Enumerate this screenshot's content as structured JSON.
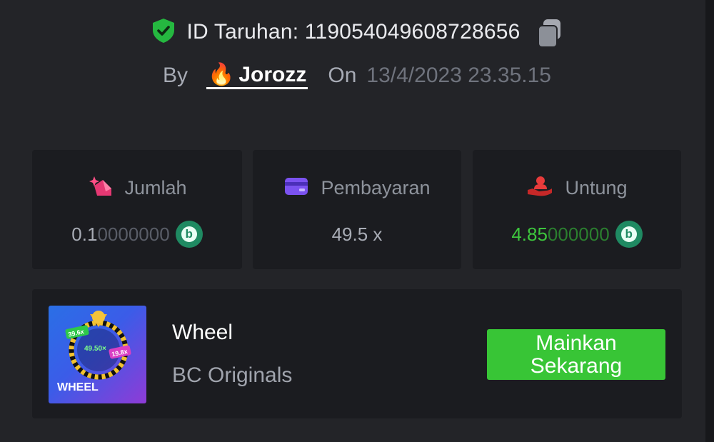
{
  "header": {
    "bet_id_label": "ID Taruhan:",
    "bet_id": "119054049608728656",
    "by_label": "By",
    "username": "Jorozz",
    "user_icon": "🔥",
    "on_label": "On",
    "date": "13/4/2023 23.35.15"
  },
  "stats": {
    "amount": {
      "label": "Jumlah",
      "value_main": "0.1",
      "value_dim": "0000000"
    },
    "payout": {
      "label": "Pembayaran",
      "value": "49.5 x"
    },
    "profit": {
      "label": "Untung",
      "value_main": "4.85",
      "value_dim": "000000"
    }
  },
  "game": {
    "name": "Wheel",
    "provider": "BC Originals",
    "play_label_line1": "Mainkan",
    "play_label_line2": "Sekarang",
    "thumb_title": "WHEEL",
    "thumb_multiplier_main": "49.50×",
    "thumb_multiplier_left": "39.6x",
    "thumb_multiplier_right": "19.8x"
  },
  "colors": {
    "background": "#232428",
    "card": "#1b1c20",
    "accent_green": "#38c536",
    "profit_green": "#3dc53d",
    "coin": "#1f8a62"
  },
  "icons": {
    "verified": "shield-check-icon",
    "copy": "copy-icon",
    "amount": "bet-amount-icon",
    "payout": "card-icon",
    "profit": "hand-person-icon",
    "coin": "bc-coin-icon"
  }
}
